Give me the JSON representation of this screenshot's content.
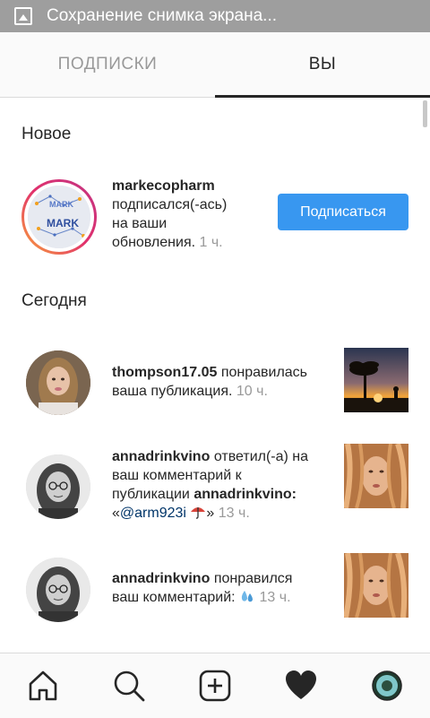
{
  "status_bar": {
    "title": "Сохранение снимка экрана..."
  },
  "tabs": {
    "following": "ПОДПИСКИ",
    "you": "ВЫ"
  },
  "sections": {
    "new": "Новое",
    "today": "Сегодня"
  },
  "new_items": [
    {
      "username": "markecopharm",
      "line1": "подписался(-ась)",
      "line2": "на ваши",
      "line3": "обновления.",
      "time": "1 ч.",
      "button": "Подписаться",
      "avatar_text_top": "MARK",
      "avatar_text_bottom": "MARK"
    }
  ],
  "today_items": [
    {
      "username": "thompson17.05",
      "action": "понравилась",
      "line2": "ваша публикация.",
      "time": "10 ч."
    },
    {
      "username": "annadrinkvino",
      "action": "ответил(-а) на",
      "line2": "ваш комментарий к",
      "line3_prefix": "публикации",
      "line3_user": "annadrinkvino:",
      "quote_open": "«",
      "mention": "@arm923i",
      "quote_close": "»",
      "time": "13 ч.",
      "emoji": "umbrella"
    },
    {
      "username": "annadrinkvino",
      "action": "понравился",
      "line2": "ваш комментарий:",
      "time": "13 ч.",
      "emoji": "sweat-drops"
    }
  ],
  "bottom_nav": [
    "home-icon",
    "search-icon",
    "add-icon",
    "heart-icon",
    "profile-avatar"
  ],
  "colors": {
    "accent": "#3897f0",
    "status_bar": "#9e9e9e",
    "muted": "#999999",
    "link": "#003569"
  }
}
